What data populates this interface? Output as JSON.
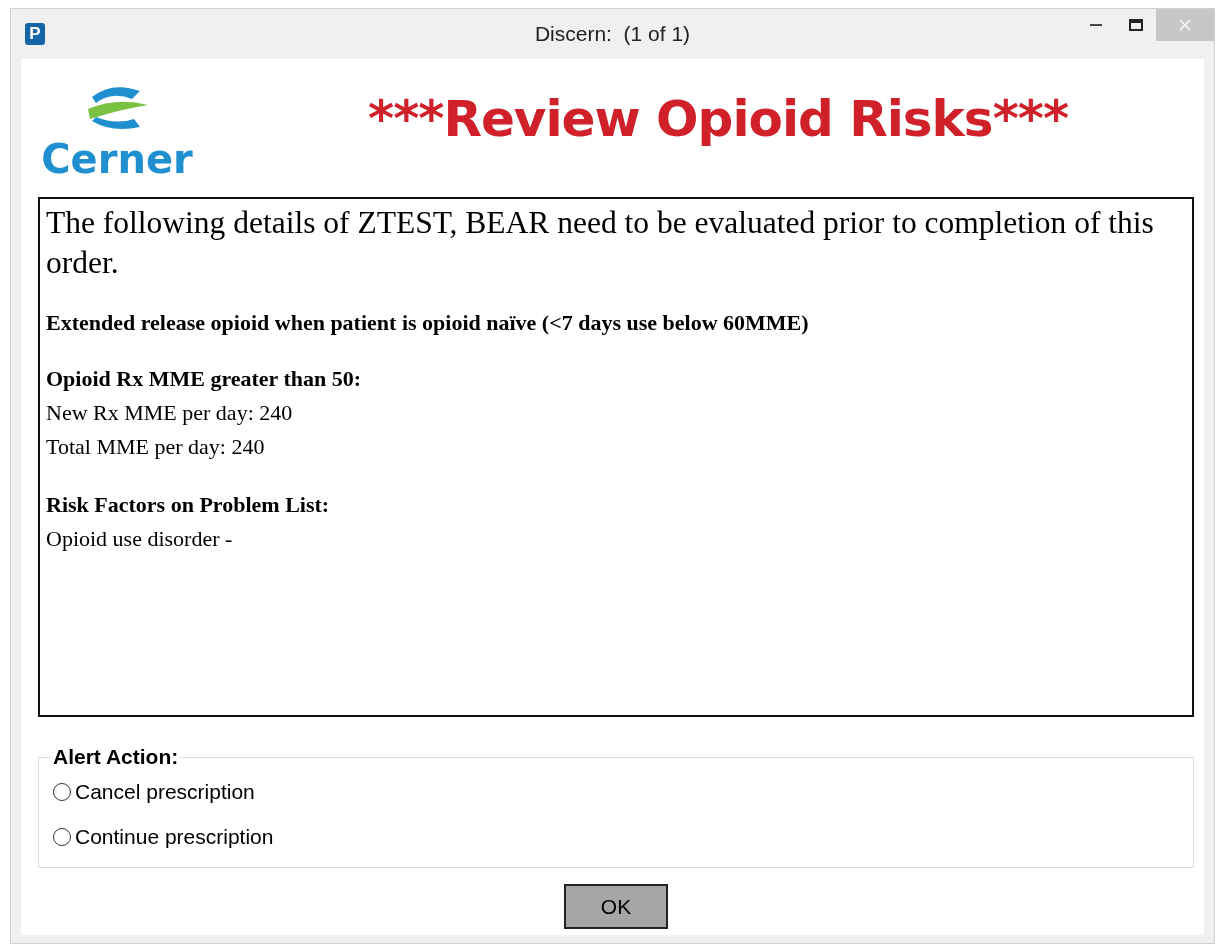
{
  "window": {
    "title": "Discern:  (1 of 1)",
    "app_icon": "P"
  },
  "logo": {
    "text": "Cerner"
  },
  "heading": "***Review Opioid Risks***",
  "message": [
    {
      "kind": "paragraph",
      "text": "The following details of ZTEST, BEAR need to be evaluated prior to completion of this order."
    },
    {
      "kind": "bold",
      "text": "Extended release opioid when patient is opioid naïve (<7 days use below 60MME)"
    },
    {
      "kind": "section",
      "title": "Opioid Rx MME greater than 50:",
      "lines": [
        "New Rx MME per day: 240",
        "Total MME per day: 240"
      ]
    },
    {
      "kind": "section",
      "title": "Risk Factors on Problem List:",
      "lines": [
        "Opioid use disorder -"
      ]
    }
  ],
  "alert_action": {
    "legend": "Alert Action:",
    "options": [
      {
        "label": "Cancel prescription",
        "selected": false
      },
      {
        "label": "Continue prescription",
        "selected": false
      }
    ]
  },
  "buttons": [
    "OK"
  ]
}
